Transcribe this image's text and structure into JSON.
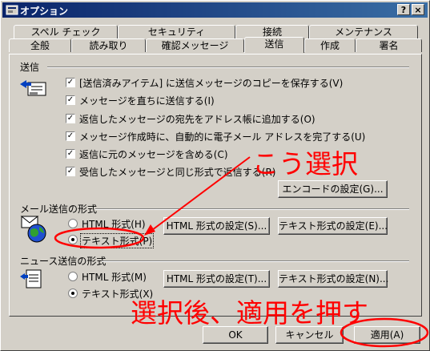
{
  "window": {
    "title": "オプション",
    "help_label": "?",
    "close_label": "×"
  },
  "tabs_row1": [
    "スペル チェック",
    "セキュリティ",
    "接続",
    "メンテナンス"
  ],
  "tabs_row2": [
    "全般",
    "読み取り",
    "確認メッセージ",
    "送信",
    "作成",
    "署名"
  ],
  "send": {
    "section_title": "送信",
    "options": [
      "[送信済みアイテム] に送信メッセージのコピーを保存する(V)",
      "メッセージを直ちに送信する(I)",
      "返信したメッセージの宛先をアドレス帳に追加する(O)",
      "メッセージ作成時に、自動的に電子メール アドレスを完了する(U)",
      "返信に元のメッセージを含める(C)",
      "受信したメッセージと同じ形式で返信する(R)"
    ],
    "encode_button": "エンコードの設定(G)..."
  },
  "mail_format": {
    "section_title": "メール送信の形式",
    "html_label": "HTML 形式(H)",
    "text_label": "テキスト形式(P)",
    "html_settings_button": "HTML 形式の設定(S)...",
    "text_settings_button": "テキスト形式の設定(E)..."
  },
  "news_format": {
    "section_title": "ニュース送信の形式",
    "html_label": "HTML 形式(M)",
    "text_label": "テキスト形式(X)",
    "html_settings_button": "HTML 形式の設定(T)...",
    "text_settings_button": "テキスト形式の設定(N)..."
  },
  "buttons": {
    "ok": "OK",
    "cancel": "キャンセル",
    "apply": "適用(A)"
  },
  "annotations": {
    "choose": "こう選択",
    "apply_hint": "選択後、適用を押す"
  },
  "colors": {
    "titlebar": "#0a246a",
    "annotation": "#ff0000",
    "face": "#d4d0c8"
  }
}
